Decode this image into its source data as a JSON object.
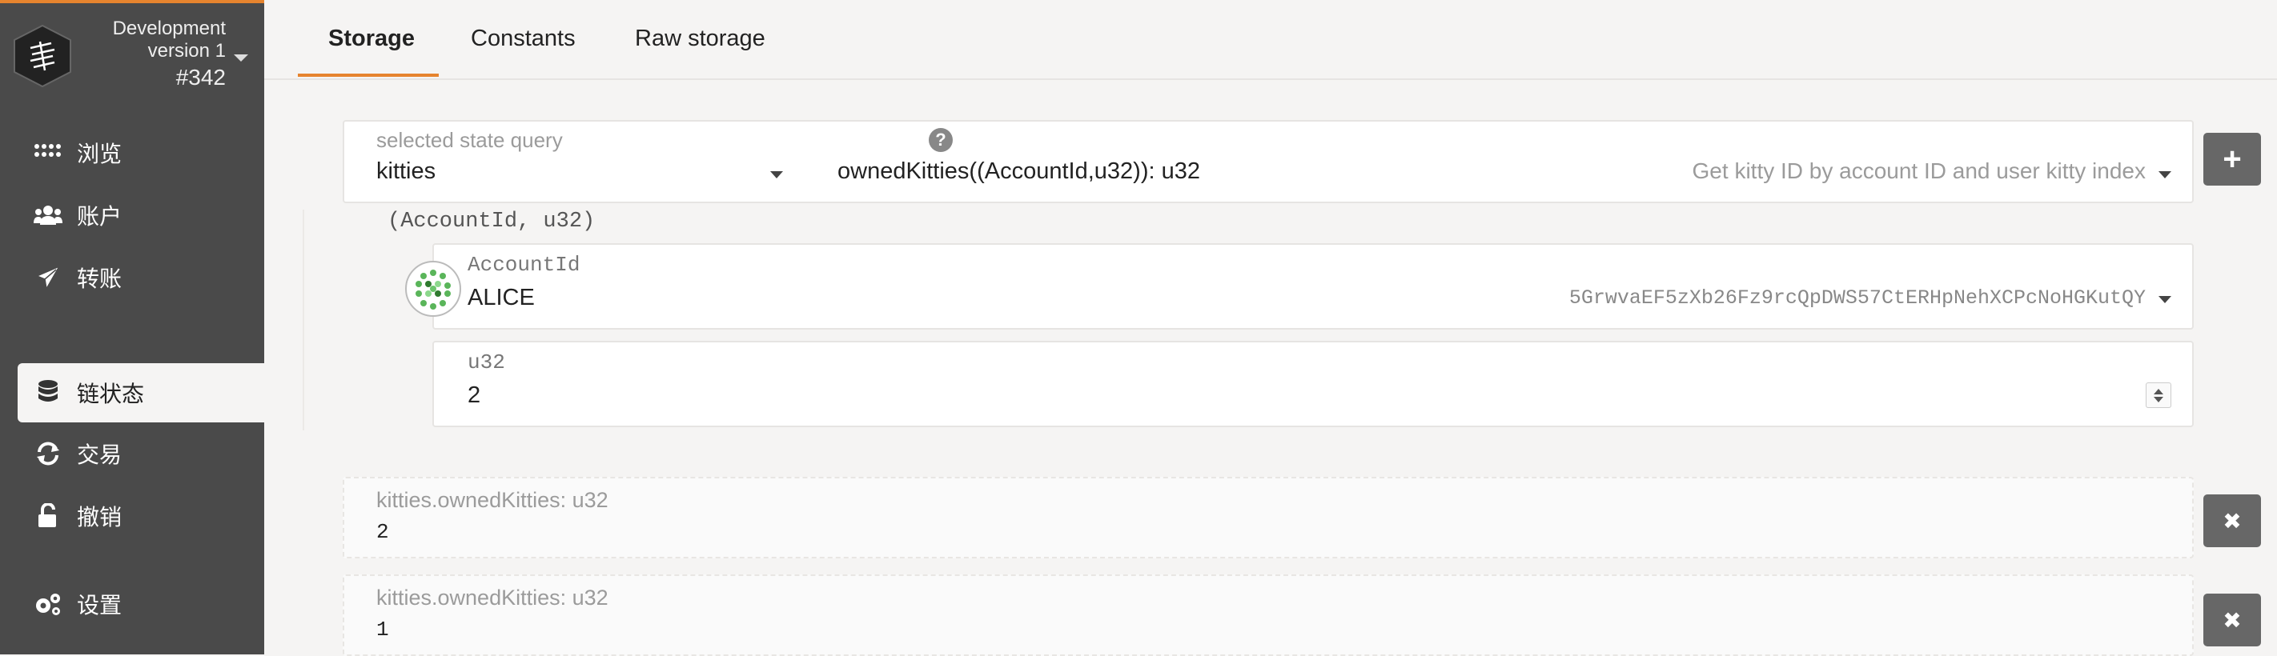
{
  "chain": {
    "name": "Development",
    "version": "version 1",
    "block": "#342"
  },
  "nav": {
    "items": [
      {
        "label": "浏览",
        "icon": "grid-dots-icon"
      },
      {
        "label": "账户",
        "icon": "users-icon"
      },
      {
        "label": "转账",
        "icon": "paper-plane-icon"
      },
      {
        "label": "链状态",
        "icon": "database-icon",
        "active": true
      },
      {
        "label": "交易",
        "icon": "sync-icon"
      },
      {
        "label": "撤销",
        "icon": "unlock-icon"
      },
      {
        "label": "设置",
        "icon": "cogs-icon"
      }
    ]
  },
  "tabs": [
    {
      "label": "Storage",
      "active": true
    },
    {
      "label": "Constants"
    },
    {
      "label": "Raw storage"
    }
  ],
  "query": {
    "label": "selected state query",
    "module": "kitties",
    "method": "ownedKitties((AccountId,u32)): u32",
    "description": "Get kitty ID by account ID and user kitty index",
    "params_hint": "(AccountId, u32)",
    "add_button": "+"
  },
  "params": {
    "account": {
      "label": "AccountId",
      "value": "ALICE",
      "address": "5GrwvaEF5zXb26Fz9rcQpDWS57CtERHpNehXCPcNoHGKutQY"
    },
    "u32": {
      "label": "u32",
      "value": "2"
    }
  },
  "results": [
    {
      "label": "kitties.ownedKitties: u32",
      "value": "2"
    },
    {
      "label": "kitties.ownedKitties: u32",
      "value": "1"
    }
  ],
  "remove_button": "✖",
  "colors": {
    "sidebar": "#4a4a4a",
    "accent": "#e6842e",
    "background": "#f5f4f3"
  }
}
